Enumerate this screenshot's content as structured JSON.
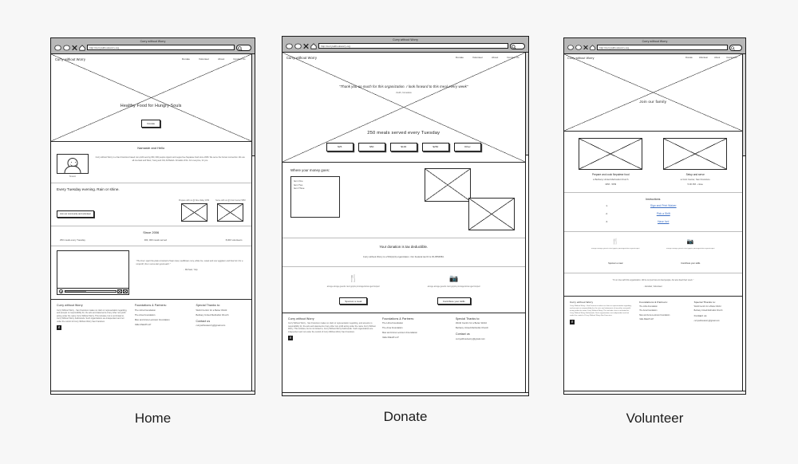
{
  "site": {
    "brand": "Curry without Worry",
    "url": "http://currywithoutworry.org",
    "window_title": "Curry without Worry",
    "nav": [
      "Donate",
      "Volunteer",
      "About",
      "Contact Us"
    ]
  },
  "footer": {
    "col1_heading": "Curry without Worry",
    "col1_text": "Curry Without Worry - San Francisco makes no claim or representation regarding, and accepts no responsibility for, the acts and statements of any other non-profit acting under the name Curry Without Worry. This includes, but is not limited to, Curry Without Worry Kathmandu. Such organizations are independent and not under the control of Curry Without Worry San Francisco.",
    "col2_heading": "Foundations & Partners:",
    "col2_items": [
      "The Libra Foundation",
      "The Ama Foundation",
      "Max and Anna Levinson Foundation",
      "Valle Makoff LLP"
    ],
    "col3_heading": "Special Thanks to:",
    "col3_items": [
      "World Centric for a Better World",
      "Bethany United Methodist Church"
    ],
    "contact_heading": "Contact us",
    "contact_email": "currywithoutworry@gmail.com",
    "social_icon": "facebook-icon"
  },
  "home": {
    "caption": "Home",
    "hero_title": "Healthy Food for Hungry Souls",
    "hero_button": "Donate",
    "about_heading": "Namaste and Hello",
    "about_text": "Curry without Worry is a San Francisco based non-profit serving 300, 000 people organic and vegan-free Nepalese food since 2006. We serve the human connection. We are all one East and West, Young and Old, All Beliefs. All walks of life. For everyone, for you.",
    "avatar_caption": "Sneson",
    "schedule_heading": "Every Tuesday evening. Rain or shine.",
    "volunteer_button": "Join our community and volunteer",
    "shift1_label": "Prepare with us @ Noe Valley 1PM",
    "shift2_label": "Serve with us @ Civic Center 5PM",
    "stats_heading": "Since 2006",
    "stats": [
      "250 meals every Tuesday",
      "300, 000 meals served",
      "8,000 volunteers"
    ],
    "testimonial": "\"The time I spent the plate consisted of bean stew, cauliflower curry, white rice, sweet and sour eggplant, and fried roti. For a nonprofit, this is some darn good eatin'.\"",
    "testimonial_attr": "- Michael, Yelp"
  },
  "donate": {
    "caption": "Donate",
    "hero_quote": "\"Thank you so much for this organization. I look forward to this meal every week\"",
    "hero_quote_attr": "-Keith, homeless",
    "hero_title": "250 meals served every Tuesday",
    "amounts": [
      "$25",
      "$50",
      "$100",
      "$250",
      "Other"
    ],
    "money_heading": "Where your money goes:",
    "money_items": [
      "Item One",
      "Item Two",
      "Item Three"
    ],
    "tax_heading": "Your donation is tax deductible.",
    "tax_text": "Curry without Worry is a 501(c)(3) organization. Our Federal tax ID is 45-0552584.",
    "cta": [
      {
        "icon": "utensils-icon",
        "glyph": "🍴",
        "text": "amoge amoge gesoris rient gopris pmoragertoina ugernicoperi",
        "button": "Sponsor a meal"
      },
      {
        "icon": "camera-icon",
        "glyph": "📷",
        "text": "amoge amoge gesoris rient gopris pmoragertoina ugernicoperi",
        "button": "Contribute your skills"
      }
    ]
  },
  "volunteer": {
    "caption": "Volunteer",
    "hero_title": "Join our family",
    "roles": [
      {
        "title": "Prepare and cook Nepalese food",
        "location": "Bethany United Methodist Church",
        "time": "3PM - 5PM",
        "pin": "location-pin-icon"
      },
      {
        "title": "Setup and serve",
        "location": "Civic Center, San Francisco",
        "time": "5:30 PM - close",
        "pin": "location-pin-icon"
      }
    ],
    "instructions_heading": "Instructions",
    "steps": [
      {
        "number": "1.",
        "label": "Sign and Print Waiver"
      },
      {
        "number": "2.",
        "label": "Pick a Shift"
      },
      {
        "number": "3.",
        "label": "Have fun!"
      }
    ],
    "cta": [
      {
        "icon": "utensils-icon",
        "glyph": "🍴",
        "text": "amoge amoge gesoris rient gopris pmoragertoina ugernicoperi",
        "button": "Sponsor a meal"
      },
      {
        "icon": "camera-icon",
        "glyph": "📷",
        "text": "amoge amoge gesoris rient gopris pmoragertoina ugernicoperi",
        "button": "Contribute your skills"
      }
    ],
    "testimonial": "\"I'm in love with this organization. We're not just here to feed people, but also feed their souls.\"",
    "testimonial_attr": "- Ezekiel, Volunteer"
  },
  "colors": {
    "link": "#3d6fc4",
    "chrome": "#b8b8b8",
    "line": "#2b2b2b"
  }
}
